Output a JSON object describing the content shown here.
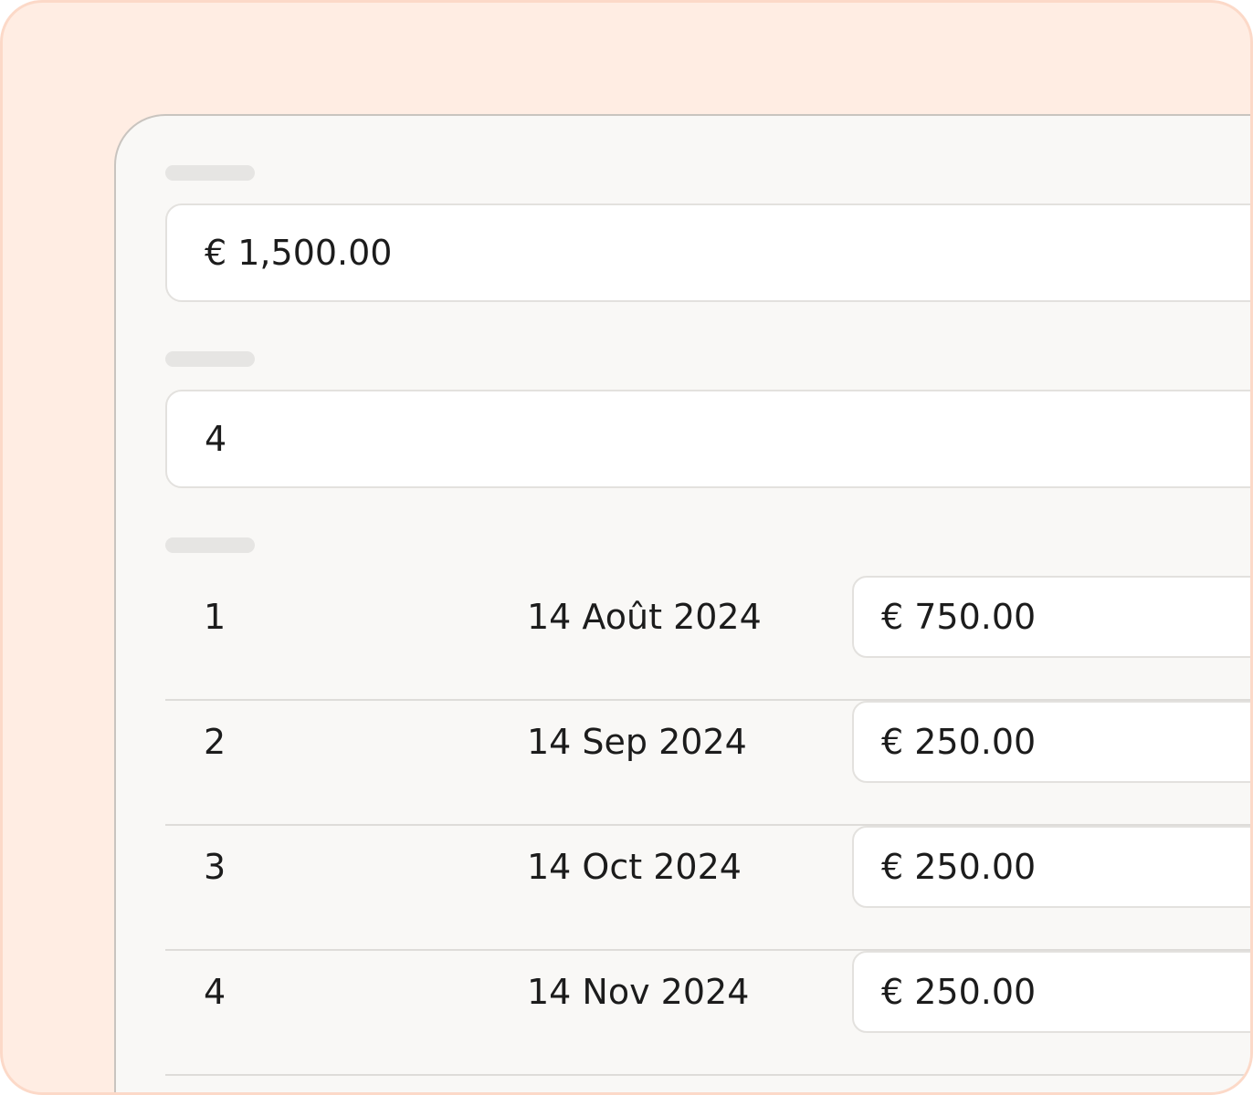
{
  "total_amount": {
    "value": "€ 1,500.00"
  },
  "installment_count": {
    "value": "4"
  },
  "schedule": {
    "rows": [
      {
        "index": "1",
        "date": "14 Août 2024",
        "amount": "€ 750.00"
      },
      {
        "index": "2",
        "date": "14 Sep 2024",
        "amount": "€ 250.00"
      },
      {
        "index": "3",
        "date": "14 Oct 2024",
        "amount": "€ 250.00"
      },
      {
        "index": "4",
        "date": "14 Nov 2024",
        "amount": "€ 250.00"
      }
    ]
  },
  "colors": {
    "background": "#ffede3",
    "background_border": "#fcd9c8",
    "panel": "#f9f8f6",
    "field": "#ffffff",
    "text": "#1c1c1c",
    "placeholder_bar": "#e6e5e3"
  }
}
